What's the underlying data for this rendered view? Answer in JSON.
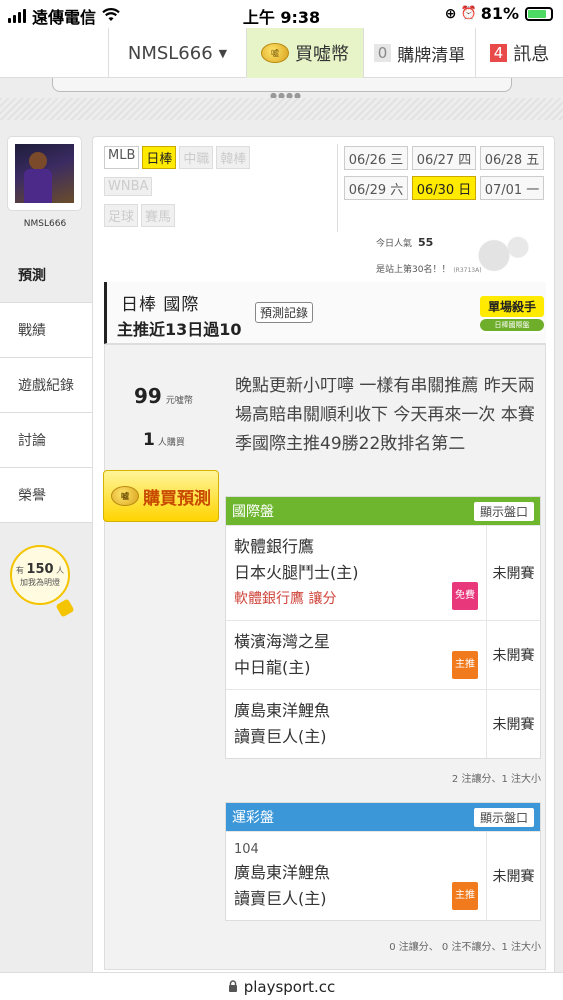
{
  "status_bar": {
    "carrier": "遠傳電信",
    "time": "上午 9:38",
    "battery": "81%"
  },
  "top_nav": {
    "username": "NMSL666",
    "coin_label": "買噓幣",
    "coin_icon_text": "噓",
    "cart_count": "0",
    "cart_label": "購牌清單",
    "message_count": "4",
    "message_label": "訊息"
  },
  "sidebar": {
    "username": "NMSL666",
    "items": [
      {
        "label": "預測",
        "active": true
      },
      {
        "label": "戰績",
        "active": false
      },
      {
        "label": "遊戲紀錄",
        "active": false
      },
      {
        "label": "討論",
        "active": false
      },
      {
        "label": "榮譽",
        "active": false
      }
    ],
    "bulb": {
      "prefix": "有",
      "count": "150",
      "unit": "人",
      "text": "加我為明燈"
    }
  },
  "leagues": {
    "row1": [
      {
        "label": "MLB",
        "state": "normal"
      },
      {
        "label": "日棒",
        "state": "selected"
      },
      {
        "label": "中職",
        "state": "disabled"
      },
      {
        "label": "韓棒",
        "state": "disabled"
      }
    ],
    "row2": [
      {
        "label": "WNBA",
        "state": "disabled"
      }
    ],
    "row3": [
      {
        "label": "足球",
        "state": "disabled"
      },
      {
        "label": "賽馬",
        "state": "disabled"
      }
    ]
  },
  "dates": [
    {
      "label": "06/26 三",
      "selected": false
    },
    {
      "label": "06/27 四",
      "selected": false
    },
    {
      "label": "06/28 五",
      "selected": false
    },
    {
      "label": "06/29 六",
      "selected": false
    },
    {
      "label": "06/30 日",
      "selected": true
    },
    {
      "label": "07/01 一",
      "selected": false
    }
  ],
  "stats": {
    "pop_label": "今日人氣",
    "pop_value": "55",
    "rank_text": "是站上第30名！！",
    "rank_small": "(R3713A)"
  },
  "header": {
    "title": "日棒 國際",
    "subtitle": "主推近13日過10",
    "record_button": "預測記錄"
  },
  "badge": {
    "title": "單場殺手",
    "subtitle": "日棒國際盤"
  },
  "purchase": {
    "price": "99",
    "price_unit": "元噓幣",
    "buyers": "1",
    "buyers_unit": "人購買",
    "buy_button": "購買預測",
    "buy_icon_text": "噓"
  },
  "description": "晚點更新小叮嚀 一樣有串關推薦 昨天兩場高賠串關順利收下 今天再來一次 本賽季國際主推49勝22敗排名第二",
  "intl_table": {
    "title": "國際盤",
    "show_button": "顯示盤口",
    "color": "#6fb62f",
    "rows": [
      {
        "team1": "軟體銀行鷹",
        "team2": "日本火腿鬥士(主)",
        "note": "軟體銀行鷹 讓分",
        "pill": "免費",
        "status": "未開賽"
      },
      {
        "team1": "橫濱海灣之星",
        "team2": "中日龍(主)",
        "note": "",
        "pill": "主推",
        "status": "未開賽"
      },
      {
        "team1": "廣島東洋鯉魚",
        "team2": "讀賣巨人(主)",
        "note": "",
        "pill": "",
        "status": "未開賽"
      }
    ],
    "footer": "2 注讓分、1 注大小"
  },
  "lottery_table": {
    "title": "運彩盤",
    "show_button": "顯示盤口",
    "color": "#3c97d9",
    "rows": [
      {
        "code": "104",
        "team1": "廣島東洋鯉魚",
        "team2": "讀賣巨人(主)",
        "pill": "主推",
        "status": "未開賽"
      }
    ],
    "footer": "0 注讓分、 0 注不讓分、1 注大小"
  },
  "url_bar": {
    "url": "playsport.cc"
  }
}
